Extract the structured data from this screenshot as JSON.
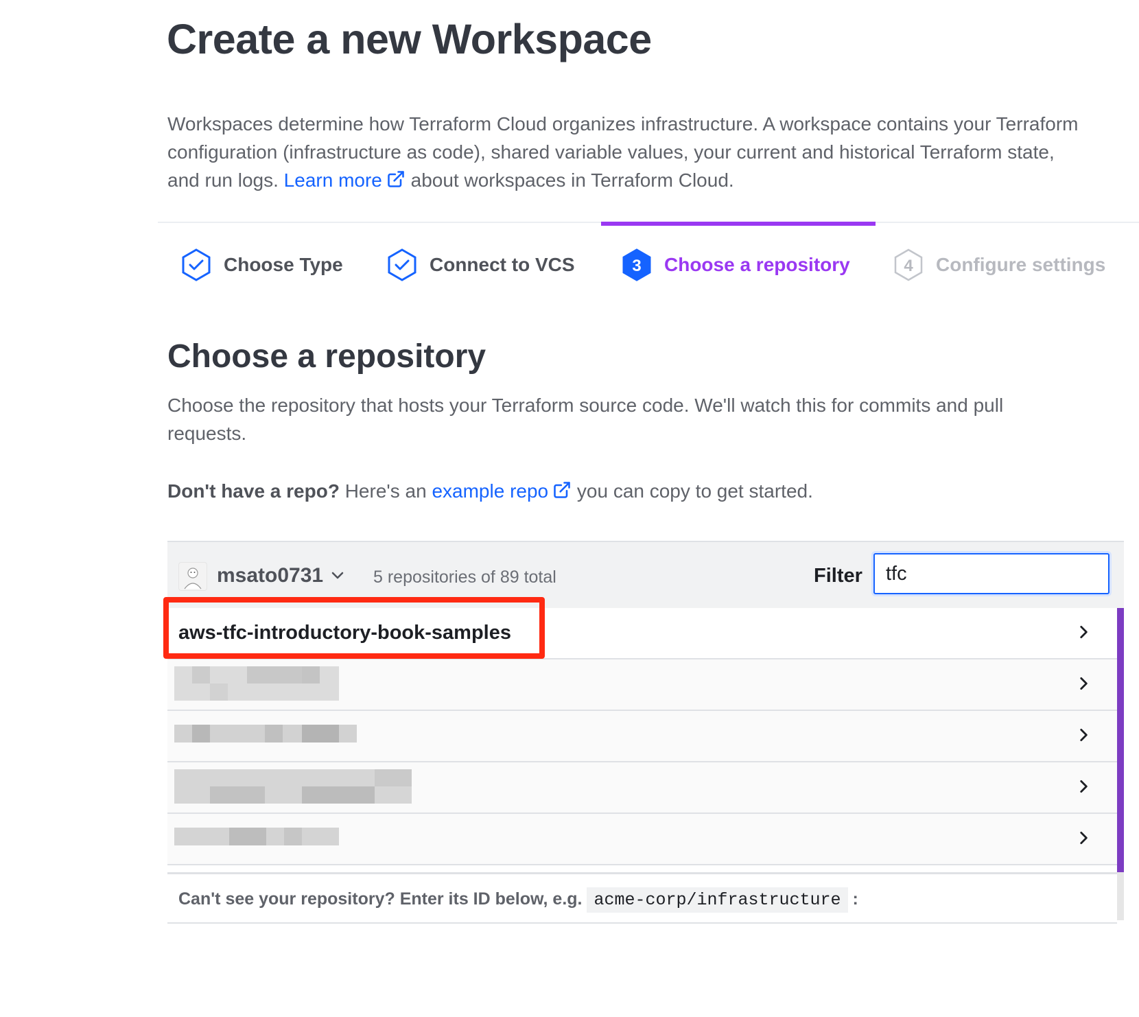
{
  "page": {
    "title": "Create a new Workspace",
    "intro": {
      "before_link": "Workspaces determine how Terraform Cloud organizes infrastructure. A workspace contains your Terraform configuration (infrastructure as code), shared variable values, your current and historical Terraform state, and run logs. ",
      "link": "Learn more",
      "after_link": " about workspaces in Terraform Cloud."
    }
  },
  "steps": [
    {
      "label": "Choose Type",
      "state": "done"
    },
    {
      "label": "Connect to VCS",
      "state": "done"
    },
    {
      "number": "3",
      "label": "Choose a repository",
      "state": "active"
    },
    {
      "number": "4",
      "label": "Configure settings",
      "state": "pending"
    }
  ],
  "section": {
    "title": "Choose a repository",
    "description": "Choose the repository that hosts your Terraform source code. We'll watch this for commits and pull requests.",
    "hint_bold": "Don't have a repo?",
    "hint_before": " Here's an ",
    "hint_link": "example repo",
    "hint_after": " you can copy to get started."
  },
  "repo_panel": {
    "account": "msato0731",
    "count": "5 repositories of 89 total",
    "filter_label": "Filter",
    "filter_value": "tfc",
    "repos": [
      "aws-tfc-introductory-book-samples"
    ],
    "footer_text": "Can't see your repository? Enter its ID below, e.g.",
    "footer_code": "acme-corp/infrastructure",
    "footer_suffix": ":"
  },
  "colors": {
    "accent": "#9a38f2",
    "link": "#1563ff",
    "highlight": "#ff2a12"
  }
}
